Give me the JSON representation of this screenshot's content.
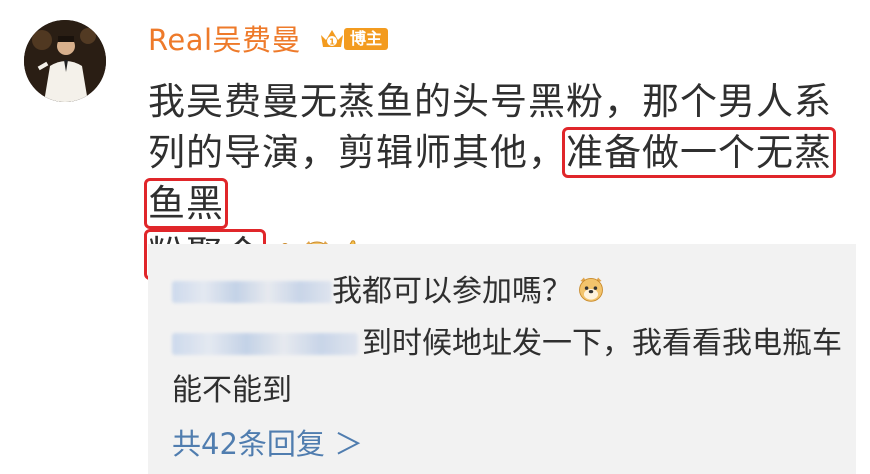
{
  "post": {
    "username": "Real吴费曼",
    "badge_label": "博主",
    "text_part1": "我吴费曼无蒸鱼的头号黑粉，那个男人系列的导演，剪辑师其他，",
    "text_highlight1": "准备做一个无蒸鱼黑",
    "text_highlight2": "粉聚会",
    "emojis": [
      "flexed-biceps-icon",
      "doge-icon",
      "thumbs-up-icon"
    ]
  },
  "replies": [
    {
      "text": "我都可以参加嗎？",
      "emoji": "doge-icon"
    },
    {
      "text": "到时候地址发一下，我看看我电瓶车能不能到"
    }
  ],
  "reply_count_label": "共42条回复 ＞",
  "colors": {
    "username": "#ee7a2a",
    "badge": "#f39b1f",
    "highlight_box": "#e0262a",
    "link": "#507daf",
    "reply_bg": "#f2f2f2"
  }
}
